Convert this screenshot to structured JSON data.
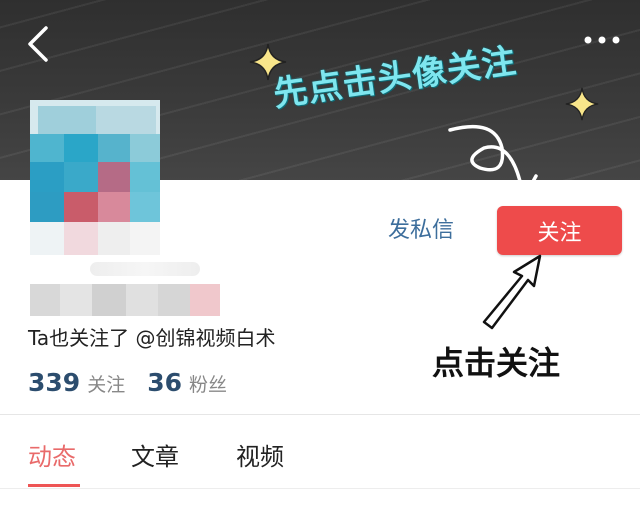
{
  "header": {
    "annotation_top": "先点击头像关注"
  },
  "actions": {
    "message_label": "发私信",
    "follow_label": "关注"
  },
  "annotation_bottom": "点击关注",
  "profile": {
    "mutual_follow_text": "Ta也关注了 @创锦视频白术",
    "stats": [
      {
        "value": "339",
        "label": "关注"
      },
      {
        "value": "36",
        "label": "粉丝"
      }
    ]
  },
  "tabs": [
    {
      "label": "动态",
      "active": true
    },
    {
      "label": "文章",
      "active": false
    },
    {
      "label": "视频",
      "active": false
    }
  ],
  "colors": {
    "follow_button": "#ee4b4b",
    "annotation_top": "#7ee6ef",
    "stat_number": "#2c4d6e",
    "link_blue": "#3d6e9c",
    "active_tab": "#e96a6a"
  },
  "icons": {
    "back": "chevron-left-icon",
    "more": "more-dots-icon"
  }
}
